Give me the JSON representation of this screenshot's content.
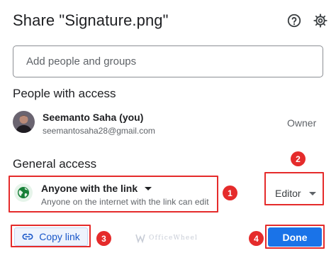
{
  "dialog": {
    "title": "Share \"Signature.png\"",
    "help_icon": "help-circle-icon",
    "settings_icon": "gear-icon"
  },
  "add_people": {
    "placeholder": "Add people and groups",
    "value": ""
  },
  "people_with_access": {
    "heading": "People with access",
    "people": [
      {
        "name": "Seemanto Saha (you)",
        "email": "seemantosaha28@gmail.com",
        "role": "Owner",
        "avatar_icon": "user-photo-avatar"
      }
    ]
  },
  "general_access": {
    "heading": "General access",
    "access_icon": "globe-icon",
    "access_color": "#188038",
    "access_label": "Anyone with the link",
    "access_description": "Anyone on the internet with the link can edit",
    "role": "Editor"
  },
  "footer": {
    "copy_link_label": "Copy link",
    "copy_link_icon": "link-icon",
    "done_label": "Done"
  },
  "annotations": {
    "color": "#e52b2b",
    "markers": [
      "1",
      "2",
      "3",
      "4"
    ]
  },
  "watermark": {
    "text": "OfficeWheel"
  },
  "colors": {
    "primary": "#1a73e8",
    "text": "#202124",
    "secondary_text": "#5f6368"
  }
}
